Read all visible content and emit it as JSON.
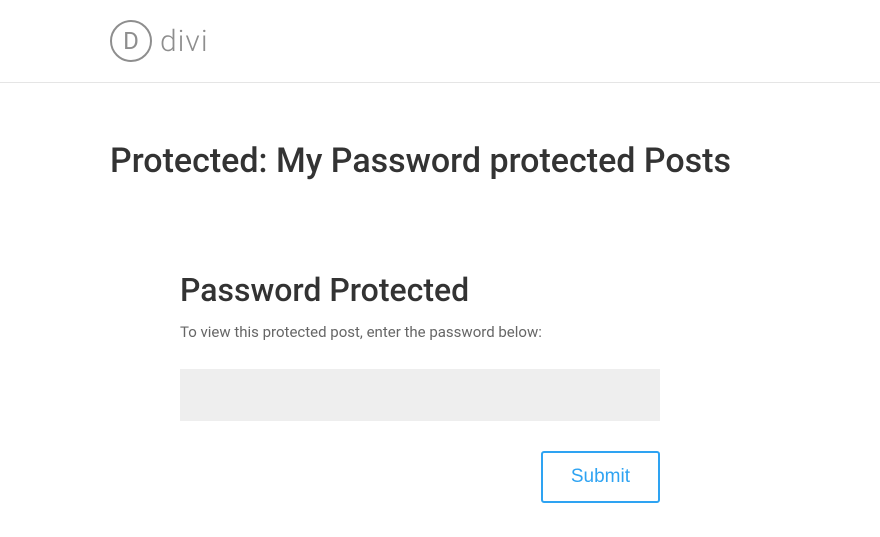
{
  "header": {
    "logo_letter": "D",
    "logo_text": "divi"
  },
  "page": {
    "title": "Protected: My Password protected Posts"
  },
  "form": {
    "heading": "Password Protected",
    "instruction": "To view this protected post, enter the password below:",
    "password_value": "",
    "submit_label": "Submit"
  },
  "colors": {
    "accent": "#2ea3f2",
    "text_dark": "#333333",
    "text_muted": "#666666",
    "input_bg": "#eeeeee",
    "border": "#e5e5e5"
  }
}
